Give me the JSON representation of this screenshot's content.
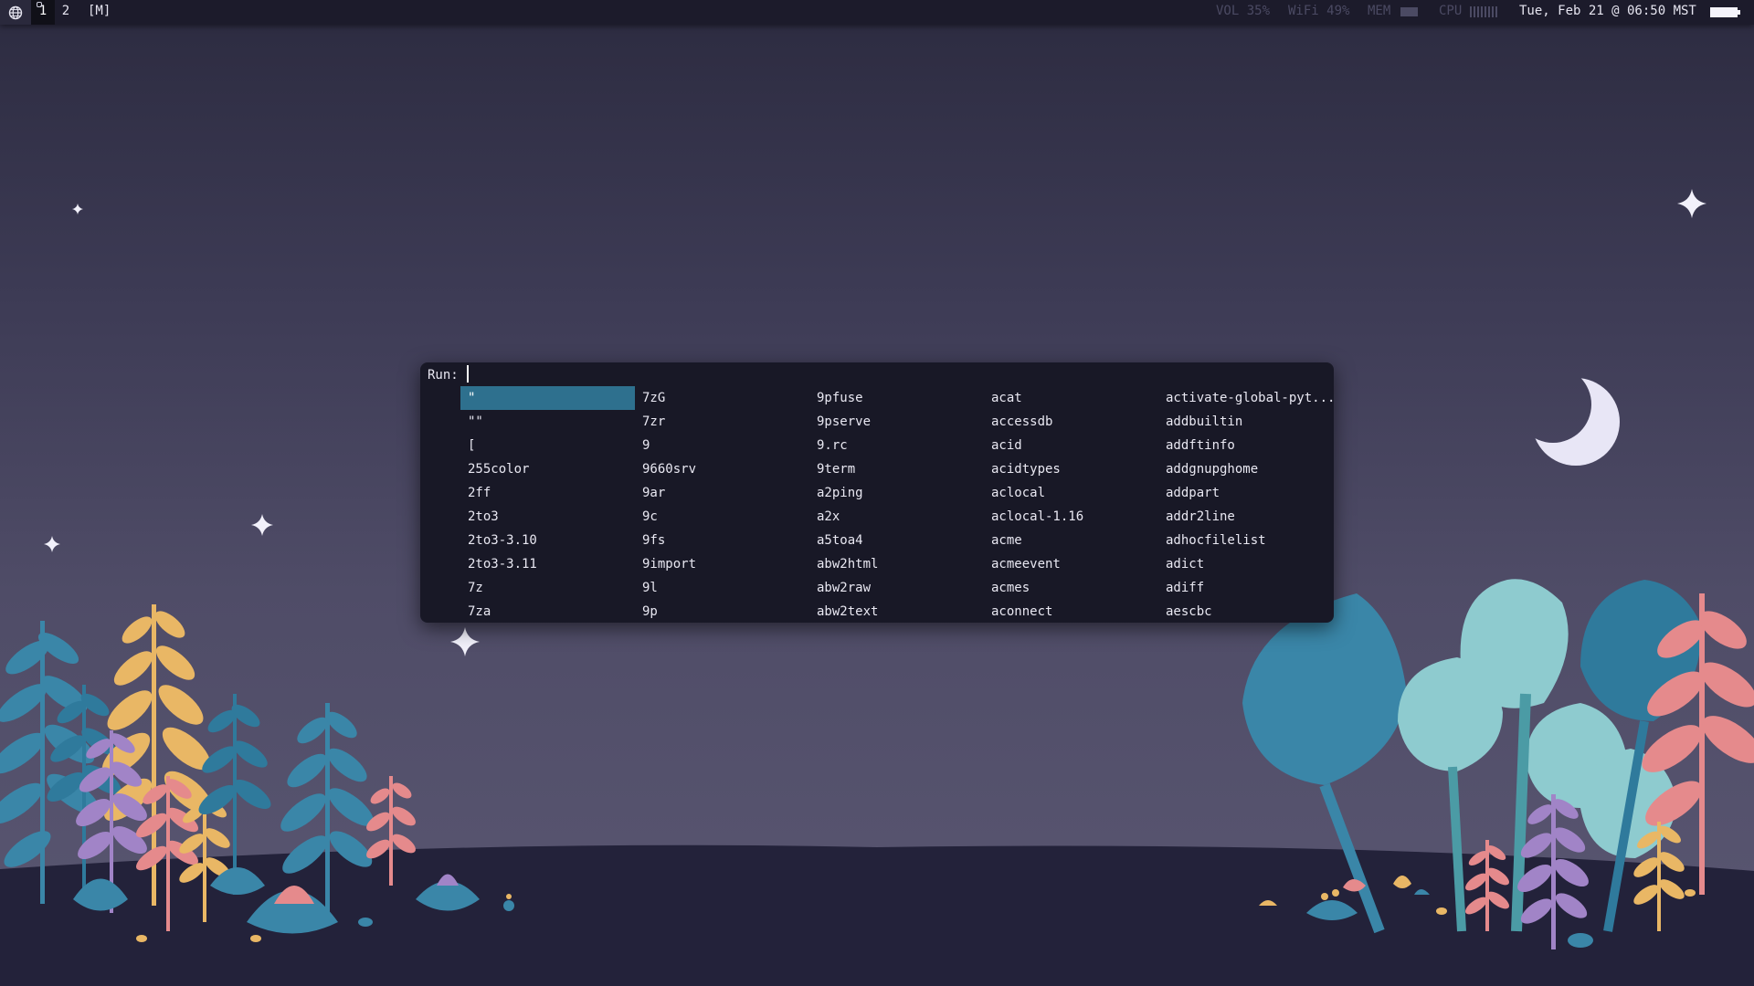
{
  "topbar": {
    "workspaces": [
      {
        "label": "1",
        "active": true
      },
      {
        "label": "2",
        "active": false
      }
    ],
    "layout": "[M]",
    "volume": "VOL 35%",
    "wifi": "WiFi 49%",
    "mem_label": "MEM",
    "cpu_label": "CPU",
    "clock": "Tue, Feb 21 @ 06:50 MST",
    "icons": [
      "globe-icon",
      "memory-bar-icon",
      "cpu-bars-icon",
      "battery-icon"
    ]
  },
  "run_dialog": {
    "prompt": "Run:",
    "input_value": "",
    "selected_index": 0,
    "selection_color": "#2e708e",
    "columns": [
      [
        "\"",
        "\"\"",
        "[",
        "255color",
        "2ff",
        "2to3",
        "2to3-3.10",
        "2to3-3.11",
        "7z",
        "7za"
      ],
      [
        "7zG",
        "7zr",
        "9",
        "9660srv",
        "9ar",
        "9c",
        "9fs",
        "9import",
        "9l",
        "9p"
      ],
      [
        "9pfuse",
        "9pserve",
        "9.rc",
        "9term",
        "a2ping",
        "a2x",
        "a5toa4",
        "abw2html",
        "abw2raw",
        "abw2text"
      ],
      [
        "acat",
        "accessdb",
        "acid",
        "acidtypes",
        "aclocal",
        "aclocal-1.16",
        "acme",
        "acmeevent",
        "acmes",
        "aconnect"
      ],
      [
        "activate-global-pyt...",
        "addbuiltin",
        "addftinfo",
        "addgnupghome",
        "addpart",
        "addr2line",
        "adhocfilelist",
        "adict",
        "adiff",
        "aescbc"
      ]
    ]
  },
  "colors": {
    "bar_bg": "#1c1b2b",
    "dialog_bg": "#181826",
    "ground": "#23223a",
    "moon": "#e8e6f6"
  }
}
